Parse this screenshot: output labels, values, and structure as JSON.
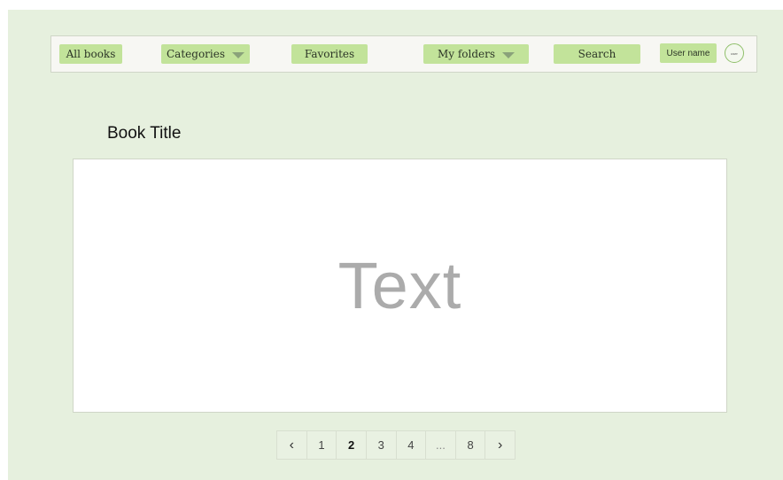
{
  "navbar": {
    "all_books": "All books",
    "categories": "Categories",
    "favorites": "Favorites",
    "my_folders": "My folders",
    "search": "Search",
    "user_name": "User name",
    "avatar_text": "user",
    "dropdown_icon": "caret-down-icon",
    "avatar_icon": "avatar"
  },
  "book": {
    "title": "Book Title",
    "content_text": "Text"
  },
  "pagination": {
    "prev_icon": "chevron-left-icon",
    "next_icon": "chevron-right-icon",
    "prev": "‹",
    "next": "›",
    "pages": [
      "1",
      "2",
      "3",
      "4",
      "...",
      "8"
    ],
    "current_page": "2"
  },
  "colors": {
    "background": "#e6f0de",
    "accent": "#c2e39a",
    "placeholder_text": "#ababab"
  }
}
